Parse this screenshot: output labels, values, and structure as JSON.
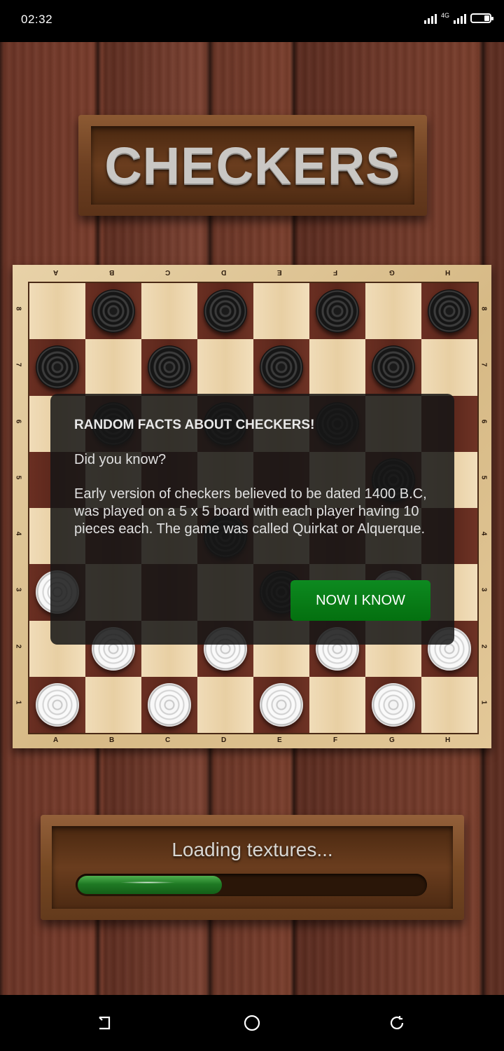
{
  "status_bar": {
    "time": "02:32",
    "network": "4G"
  },
  "title": "CHECKERS",
  "board": {
    "files": [
      "A",
      "B",
      "C",
      "D",
      "E",
      "F",
      "G",
      "H"
    ],
    "ranks": [
      "8",
      "7",
      "6",
      "5",
      "4",
      "3",
      "2",
      "1"
    ],
    "pieces": [
      {
        "square": "B8",
        "color": "black"
      },
      {
        "square": "D8",
        "color": "black"
      },
      {
        "square": "F8",
        "color": "black"
      },
      {
        "square": "H8",
        "color": "black"
      },
      {
        "square": "A7",
        "color": "black"
      },
      {
        "square": "C7",
        "color": "black"
      },
      {
        "square": "E7",
        "color": "black"
      },
      {
        "square": "G7",
        "color": "black"
      },
      {
        "square": "B6",
        "color": "black"
      },
      {
        "square": "D6",
        "color": "black"
      },
      {
        "square": "F6",
        "color": "black"
      },
      {
        "square": "G5",
        "color": "black"
      },
      {
        "square": "D4",
        "color": "black"
      },
      {
        "square": "E3",
        "color": "black"
      },
      {
        "square": "A3",
        "color": "white"
      },
      {
        "square": "G3",
        "color": "white"
      },
      {
        "square": "B2",
        "color": "white"
      },
      {
        "square": "D2",
        "color": "white"
      },
      {
        "square": "F2",
        "color": "white"
      },
      {
        "square": "H2",
        "color": "white"
      },
      {
        "square": "A1",
        "color": "white"
      },
      {
        "square": "C1",
        "color": "white"
      },
      {
        "square": "E1",
        "color": "white"
      },
      {
        "square": "G1",
        "color": "white"
      }
    ]
  },
  "dialog": {
    "title": "RANDOM FACTS ABOUT CHECKERS!",
    "question": "Did you know?",
    "body": "Early version of checkers believed to be dated 1400 B.C, was played on a 5 x 5 board with each player having 10 pieces each. The game was called Quirkat or Alquerque.",
    "button_label": "NOW I KNOW"
  },
  "loading": {
    "text": "Loading textures...",
    "progress": 0.41
  },
  "colors": {
    "button_green": "#0d8a20",
    "progress_green": "#1f7a24"
  }
}
